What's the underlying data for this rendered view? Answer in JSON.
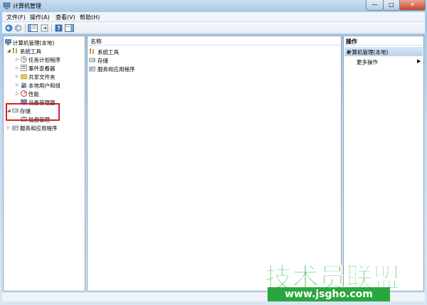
{
  "window": {
    "title": "计算机管理",
    "controls": {
      "minimize": "—",
      "maximize": "□",
      "close": "✕"
    }
  },
  "menu": [
    {
      "label": "文件(F)"
    },
    {
      "label": "操作(A)"
    },
    {
      "label": "查看(V)"
    },
    {
      "label": "帮助(H)"
    }
  ],
  "toolbar": {
    "icons": [
      "back-arrow-icon",
      "forward-arrow-icon",
      "show-hide-tree-icon",
      "export-list-icon",
      "help-icon",
      "show-hide-action-pane-icon"
    ]
  },
  "tree": {
    "root": "计算机管理(本地)",
    "system_tools": "系统工具",
    "task_scheduler": "任务计划程序",
    "event_viewer": "事件查看器",
    "shared_folders": "共享文件夹",
    "local_users": "本地用户和组",
    "performance": "性能",
    "device_manager": "设备管理器",
    "storage": "存储",
    "disk_management": "磁盘管理",
    "services_apps": "服务和应用程序"
  },
  "main": {
    "column_header": "名称",
    "items": [
      {
        "label": "系统工具",
        "icon": "tools-icon"
      },
      {
        "label": "存储",
        "icon": "storage-icon"
      },
      {
        "label": "服务和应用程序",
        "icon": "services-icon"
      }
    ]
  },
  "actions": {
    "title": "操作",
    "section": "计算机管理(本地)",
    "section_arrow": "▲",
    "more": "更多操作",
    "more_arrow": "▶"
  },
  "watermark": {
    "brand": "技术员联盟",
    "url": "www.jsgho.com"
  },
  "colors": {
    "highlight_border": "#e11d2a",
    "watermark_green": "#39b54a"
  }
}
